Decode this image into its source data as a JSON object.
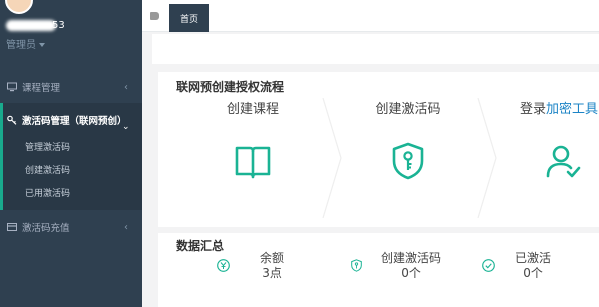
{
  "profile": {
    "name_suffix": "53",
    "role": "管理员"
  },
  "sidebar": {
    "items": [
      {
        "label": "课程管理",
        "icon": "desktop-icon"
      },
      {
        "label": "激活码管理（联网预创）",
        "icon": "key-icon"
      },
      {
        "label": "激活码充值",
        "icon": "card-icon"
      }
    ],
    "subitems": [
      "管理激活码",
      "创建激活码",
      "已用激活码"
    ]
  },
  "topbar": {
    "home_tab": "首页"
  },
  "flow": {
    "title": "联网预创建授权流程",
    "steps": [
      {
        "label": "创建课程",
        "icon": "book-icon"
      },
      {
        "label": "创建激活码",
        "icon": "shield-key-icon"
      },
      {
        "label_prefix": "登录",
        "label_link": "加密工具",
        "icon": "user-check-icon"
      }
    ]
  },
  "stats": {
    "title": "数据汇总",
    "items": [
      {
        "label": "余额",
        "value": "3点",
        "icon": "yen-icon"
      },
      {
        "label": "创建激活码",
        "value": "0个",
        "icon": "shield-key-icon"
      },
      {
        "label": "已激活",
        "value": "0个",
        "icon": "check-circle-icon"
      }
    ]
  },
  "colors": {
    "sidebar": "#2f4050",
    "accent": "#1ab394",
    "link": "#1c84c6"
  }
}
